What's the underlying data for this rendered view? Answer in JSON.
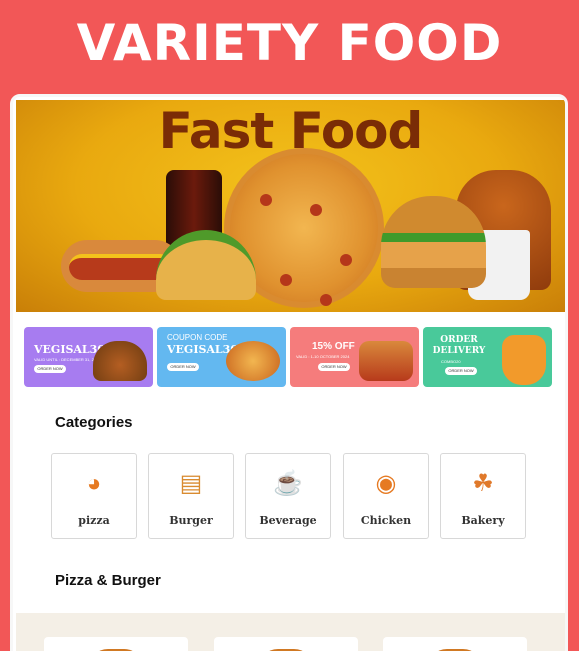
{
  "headline": "VARIETY FOOD",
  "hero": {
    "title": "Fast Food"
  },
  "coupons": [
    {
      "code": "VEGISAL30",
      "line1": "",
      "valid": "VALID UNTIL : DECEMBER 31, 2024",
      "button": "ORDER NOW",
      "color": "#a77cf0",
      "food_icon": "burger-image"
    },
    {
      "line1": "COUPON CODE",
      "code": "VEGISAL30",
      "valid": "",
      "button": "ORDER NOW",
      "color": "#63b8f0",
      "food_icon": "pizza-image"
    },
    {
      "code": "15% OFF",
      "line1": "",
      "valid": "VALID : 1-10 OCTOBER 2024",
      "button": "ORDER NOW",
      "color": "#f57c7c",
      "food_icon": "fries-hotdog-image"
    },
    {
      "code": "ORDER DELIVERY",
      "line1": "COMBO20",
      "valid": "",
      "button": "ORDER NOW",
      "color": "#49c99a",
      "food_icon": "delivery-scooter-image"
    }
  ],
  "categories": {
    "title": "Categories",
    "items": [
      {
        "label": "pizza",
        "icon": "pizza-icon"
      },
      {
        "label": "Burger",
        "icon": "burger-icon"
      },
      {
        "label": "Beverage",
        "icon": "beverage-icon"
      },
      {
        "label": "Chicken",
        "icon": "chicken-icon"
      },
      {
        "label": "Bakery",
        "icon": "bakery-icon"
      }
    ]
  },
  "section": {
    "title": "Pizza & Burger"
  },
  "colors": {
    "background": "#f25757",
    "accent": "#e67a22",
    "strip": "#f4efe6"
  }
}
